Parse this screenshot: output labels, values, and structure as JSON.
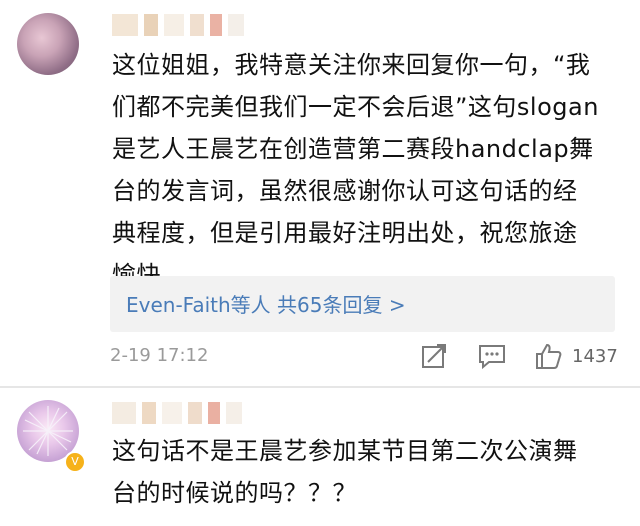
{
  "comments": [
    {
      "text": "这位姐姐，我特意关注你来回复你一句，“我\n们都不完美但我们一定不会后退”这句slogan\n是艺人王晨艺在创造营第二赛段handclap舞\n台的发言词，虽然很感谢你认可这句话的经\n典程度，但是引用最好注明出处，祝您旅途\n愉快。",
      "replies_link": "Even-Faith等人  共65条回复 >",
      "timestamp": "2-19 17:12",
      "likes": "1437",
      "icons": [
        "share-icon",
        "comment-icon",
        "like-icon"
      ]
    },
    {
      "text": "这句话不是王晨艺参加某节目第二次公演舞\n台的时候说的吗？？？",
      "verified_badge": "V"
    }
  ],
  "colors": {
    "link": "#4a7cb8",
    "meta": "#9a9a9a",
    "reply_bg": "#f2f2f2",
    "badge": "#f6b21a"
  }
}
